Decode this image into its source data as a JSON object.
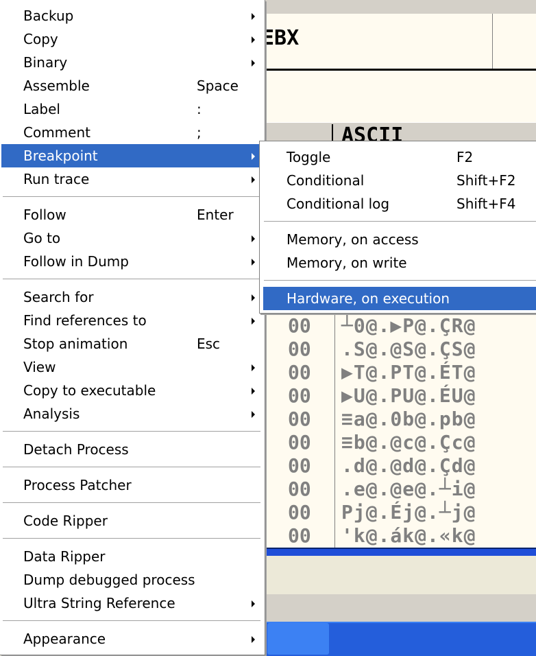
{
  "background": {
    "register_text": "EBX",
    "dump_header": "ASCII",
    "dump_rows": [
      {
        "hex": "00",
        "ascii": "┴0@.▶P@.ÇR@"
      },
      {
        "hex": "00",
        "ascii": ".S@.@S@.ÇS@"
      },
      {
        "hex": "00",
        "ascii": "▶T@.PT@.ÉT@"
      },
      {
        "hex": "00",
        "ascii": "▶U@.PU@.ÉU@"
      },
      {
        "hex": "00",
        "ascii": "≡a@.0b@.pb@"
      },
      {
        "hex": "00",
        "ascii": "≡b@.@c@.Çc@"
      },
      {
        "hex": "00",
        "ascii": ".d@.@d@.Çd@"
      },
      {
        "hex": "00",
        "ascii": ".e@.@e@.┴i@"
      },
      {
        "hex": "00",
        "ascii": "Pj@.Éj@.┴j@"
      },
      {
        "hex": "00",
        "ascii": "'k@.ák@.«k@"
      }
    ]
  },
  "context_menu": {
    "items": [
      {
        "label": "Backup",
        "shortcut": "",
        "submenu": true
      },
      {
        "label": "Copy",
        "shortcut": "",
        "submenu": true
      },
      {
        "label": "Binary",
        "shortcut": "",
        "submenu": true
      },
      {
        "label": "Assemble",
        "shortcut": "Space",
        "submenu": false
      },
      {
        "label": "Label",
        "shortcut": ":",
        "submenu": false
      },
      {
        "label": "Comment",
        "shortcut": ";",
        "submenu": false
      },
      {
        "label": "Breakpoint",
        "shortcut": "",
        "submenu": true,
        "active": true
      },
      {
        "label": "Run trace",
        "shortcut": "",
        "submenu": true
      },
      {
        "label": "Follow",
        "shortcut": "Enter",
        "submenu": false
      },
      {
        "label": "Go to",
        "shortcut": "",
        "submenu": true
      },
      {
        "label": "Follow in Dump",
        "shortcut": "",
        "submenu": true
      },
      {
        "label": "Search for",
        "shortcut": "",
        "submenu": true
      },
      {
        "label": "Find references to",
        "shortcut": "",
        "submenu": true
      },
      {
        "label": "Stop animation",
        "shortcut": "Esc",
        "submenu": false
      },
      {
        "label": "View",
        "shortcut": "",
        "submenu": true
      },
      {
        "label": "Copy to executable",
        "shortcut": "",
        "submenu": true
      },
      {
        "label": "Analysis",
        "shortcut": "",
        "submenu": true
      },
      {
        "label": "Detach Process",
        "shortcut": "",
        "submenu": false
      },
      {
        "label": "Process Patcher",
        "shortcut": "",
        "submenu": false
      },
      {
        "label": "Code Ripper",
        "shortcut": "",
        "submenu": false
      },
      {
        "label": "Data Ripper",
        "shortcut": "",
        "submenu": false
      },
      {
        "label": "Dump debugged process",
        "shortcut": "",
        "submenu": false
      },
      {
        "label": "Ultra String Reference",
        "shortcut": "",
        "submenu": true
      },
      {
        "label": "Appearance",
        "shortcut": "",
        "submenu": true
      }
    ]
  },
  "breakpoint_submenu": {
    "items": [
      {
        "label": "Toggle",
        "shortcut": "F2"
      },
      {
        "label": "Conditional",
        "shortcut": "Shift+F2"
      },
      {
        "label": "Conditional log",
        "shortcut": "Shift+F4"
      },
      {
        "label": "Memory, on access",
        "shortcut": ""
      },
      {
        "label": "Memory, on write",
        "shortcut": ""
      },
      {
        "label": "Hardware, on execution",
        "shortcut": "",
        "active": true
      }
    ]
  }
}
